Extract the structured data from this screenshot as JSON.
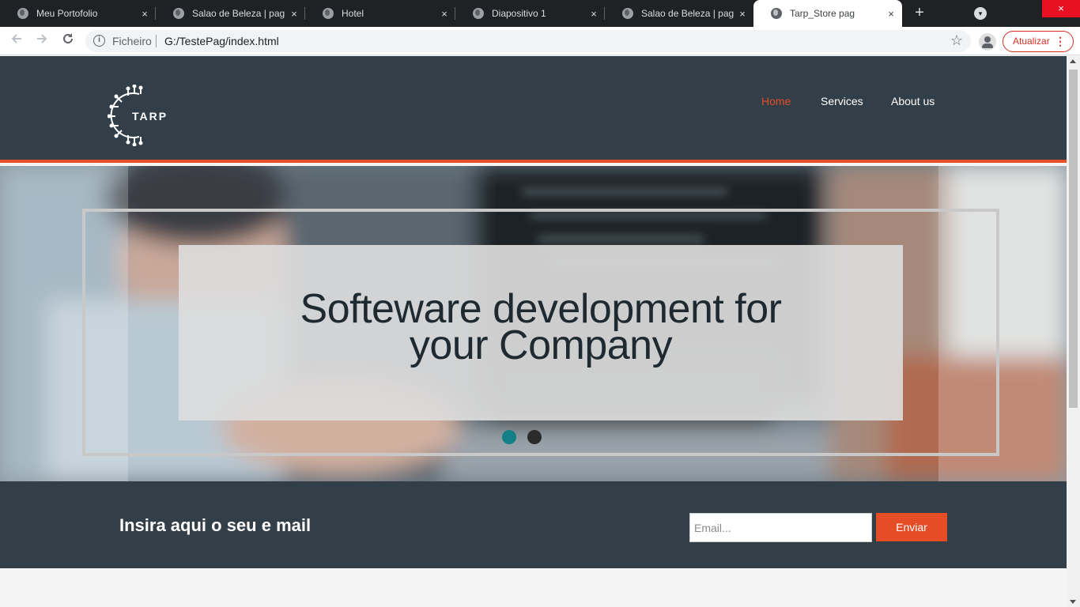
{
  "browser": {
    "tabs": [
      {
        "title": "Meu Portofolio"
      },
      {
        "title": "Salao de Beleza | pag ini"
      },
      {
        "title": "Hotel"
      },
      {
        "title": "Diapositivo 1"
      },
      {
        "title": "Salao de Beleza | pag ini"
      },
      {
        "title": "Tarp_Store pag"
      }
    ],
    "active_tab_index": 5,
    "new_tab_glyph": "+",
    "tab_close_glyph": "×",
    "window_close_glyph": "×",
    "address_bar": {
      "scheme_label": "Ficheiro",
      "url": "G:/TestePag/index.html"
    },
    "update_button_label": "Atualizar",
    "icons": [
      "back-arrow-icon",
      "forward-arrow-icon",
      "reload-icon",
      "info-icon",
      "bookmark-star-icon",
      "profile-icon",
      "menu-dots-icon",
      "globe-icon",
      "tab-search-icon"
    ]
  },
  "site": {
    "logo_text": "TARP",
    "nav": [
      {
        "label": "Home",
        "active": true
      },
      {
        "label": "Services",
        "active": false
      },
      {
        "label": "About us",
        "active": false
      }
    ],
    "hero": {
      "title_line1": "Softeware development for",
      "title_line2": "your Company",
      "slides_total": 2,
      "active_slide": 1
    },
    "newsletter": {
      "label": "Insira aqui o seu e mail",
      "email_placeholder": "Email...",
      "email_value": "",
      "submit_label": "Enviar"
    }
  },
  "colors": {
    "header_bg": "#333f48",
    "accent": "#e44d26",
    "active_dot": "#137f86",
    "inactive_dot": "#2b2b2b",
    "chrome_dark": "#202124",
    "window_close": "#e81123"
  }
}
